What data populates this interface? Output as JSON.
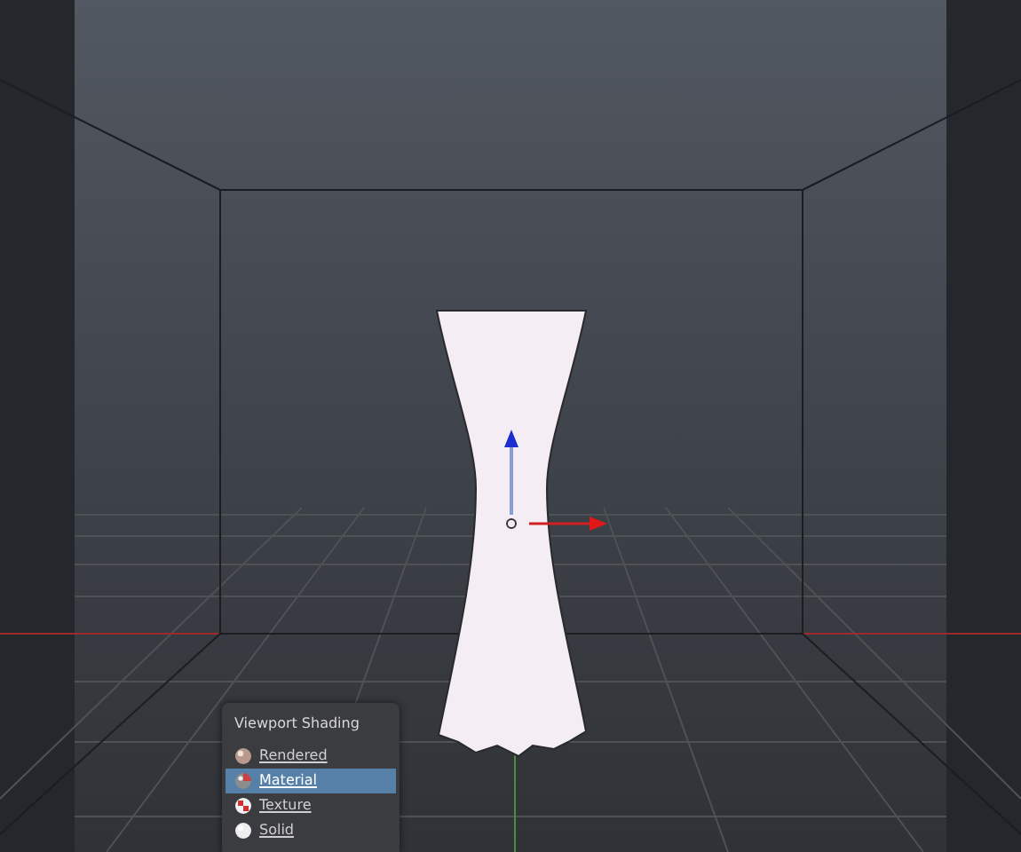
{
  "shading_menu": {
    "title": "Viewport Shading",
    "items": [
      {
        "label": "Rendered",
        "kind": "rendered",
        "selected": false
      },
      {
        "label": "Material",
        "kind": "material",
        "selected": true
      },
      {
        "label": "Texture",
        "kind": "texture",
        "selected": false
      },
      {
        "label": "Solid",
        "kind": "solid",
        "selected": false
      }
    ]
  }
}
